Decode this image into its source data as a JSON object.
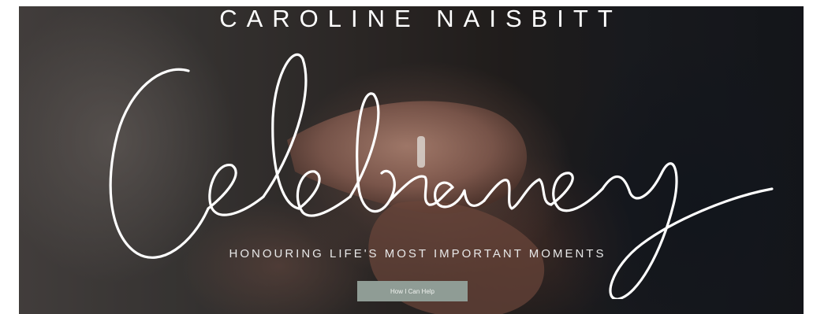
{
  "hero": {
    "brand_name": "CAROLINE NAISBITT",
    "script_title": "Celebrancy",
    "tagline": "HONOURING LIFE'S MOST IMPORTANT MOMENTS",
    "cta_label": "How I Can Help"
  },
  "colors": {
    "text": "#ffffff",
    "button_bg": "#8f9c95"
  }
}
